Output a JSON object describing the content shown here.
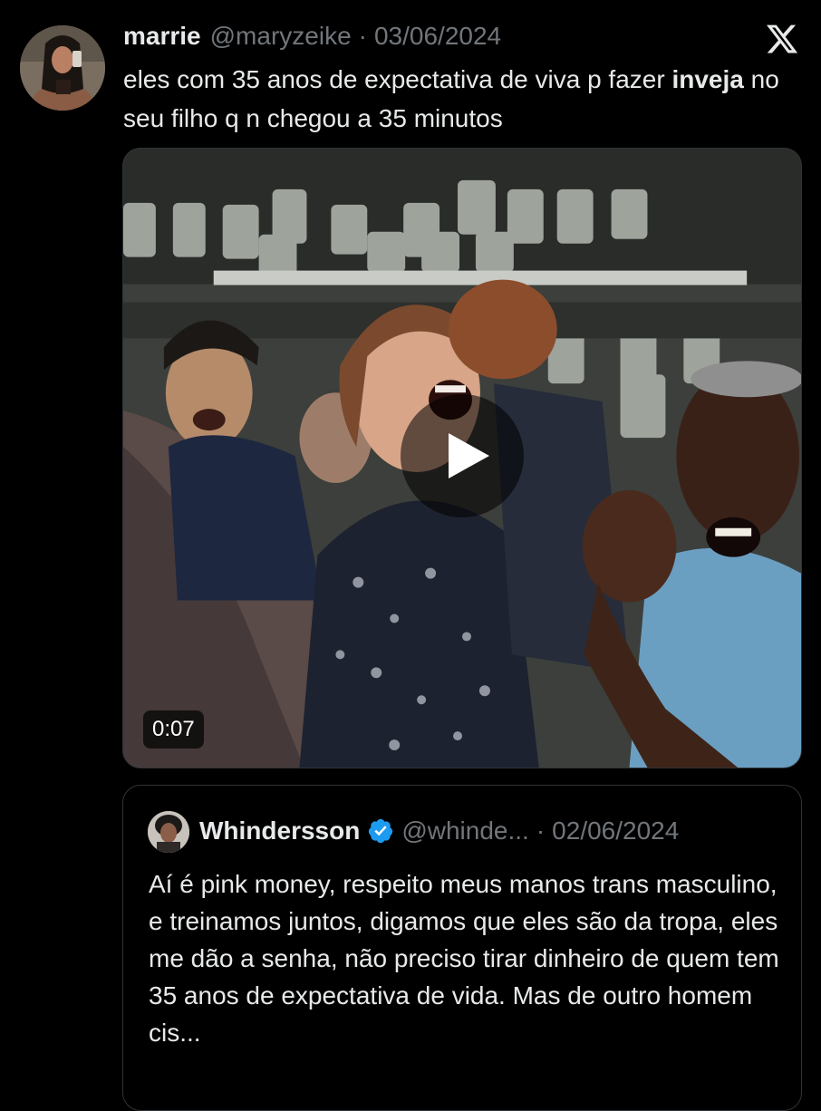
{
  "tweet": {
    "author": {
      "name": "marrie",
      "handle": "@maryzeike",
      "separator": "·",
      "date": "03/06/2024"
    },
    "text_part1": "eles com 35 anos de expectativa de viva p fazer ",
    "text_bold": "inveja",
    "text_part2": " no seu filho q n chegou a 35 minutos",
    "media": {
      "type": "video",
      "duration": "0:07"
    },
    "platform_icon": "x-logo-icon"
  },
  "quote": {
    "author": {
      "name": "Whindersson",
      "verified": true,
      "handle": "@whinde...",
      "separator": "·",
      "date": "02/06/2024"
    },
    "text": "Aí é pink money, respeito meus manos trans masculino, e treinamos juntos, digamos que eles são da tropa, eles me dão a senha, não preciso tirar dinheiro de quem tem 35 anos de expectativa de vida. Mas de outro homem cis..."
  },
  "colors": {
    "background": "#000000",
    "text_primary": "#e7e9ea",
    "text_secondary": "#71767b",
    "border": "#2f3336",
    "verified_blue": "#1d9bf0"
  }
}
